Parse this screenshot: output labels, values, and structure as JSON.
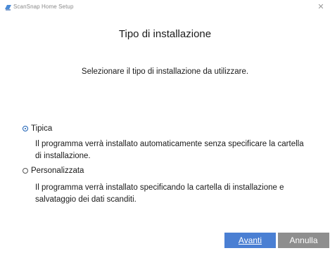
{
  "window": {
    "title": "ScanSnap Home Setup",
    "close_icon": "close-icon"
  },
  "page": {
    "title": "Tipo di installazione",
    "subtitle": "Selezionare il tipo di installazione da utilizzare."
  },
  "options": [
    {
      "label": "Tipica",
      "selected": true,
      "description": "Il programma verrà installato automaticamente senza specificare la cartella di installazione."
    },
    {
      "label": "Personalizzata",
      "selected": false,
      "description": "Il programma verrà installato specificando la cartella di installazione e salvataggio dei dati scanditi."
    }
  ],
  "buttons": {
    "next": "Avanti",
    "cancel": "Annulla"
  },
  "colors": {
    "accent": "#4a7fd3",
    "cancel": "#8e8e8e",
    "radio": "#1a5fb4"
  }
}
